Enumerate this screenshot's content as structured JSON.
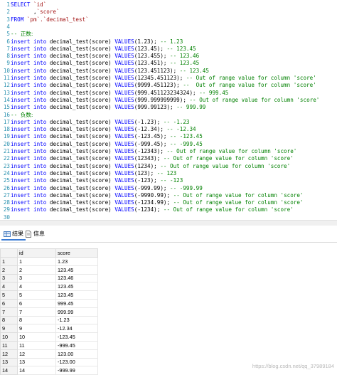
{
  "editor": {
    "lines": [
      {
        "n": "1",
        "segments": [
          {
            "t": "SELECT ",
            "c": "kw"
          },
          {
            "t": "`id`",
            "c": "str"
          }
        ]
      },
      {
        "n": "2",
        "segments": [
          {
            "t": "       ,",
            "c": "plain"
          },
          {
            "t": "`score`",
            "c": "str"
          }
        ]
      },
      {
        "n": "3",
        "segments": [
          {
            "t": "FROM ",
            "c": "kw"
          },
          {
            "t": "`pm`.`decimal_test`",
            "c": "str"
          }
        ]
      },
      {
        "n": "4",
        "segments": []
      },
      {
        "n": "5",
        "segments": [
          {
            "t": "-- ",
            "c": "cm"
          },
          {
            "t": "正数:",
            "c": "cn"
          }
        ]
      },
      {
        "n": "6",
        "segments": [
          {
            "t": "insert into ",
            "c": "kw"
          },
          {
            "t": "decimal_test(score) ",
            "c": "plain"
          },
          {
            "t": "VALUES",
            "c": "kw"
          },
          {
            "t": "(1.23); ",
            "c": "plain"
          },
          {
            "t": "-- 1.23",
            "c": "cm"
          }
        ]
      },
      {
        "n": "7",
        "segments": [
          {
            "t": "insert into ",
            "c": "kw"
          },
          {
            "t": "decimal_test(score) ",
            "c": "plain"
          },
          {
            "t": "VALUES",
            "c": "kw"
          },
          {
            "t": "(123.45); ",
            "c": "plain"
          },
          {
            "t": "-- 123.45",
            "c": "cm"
          }
        ]
      },
      {
        "n": "8",
        "segments": [
          {
            "t": "insert into ",
            "c": "kw"
          },
          {
            "t": "decimal_test(score) ",
            "c": "plain"
          },
          {
            "t": "VALUES",
            "c": "kw"
          },
          {
            "t": "(123.455); ",
            "c": "plain"
          },
          {
            "t": "-- 123.46",
            "c": "cm"
          }
        ]
      },
      {
        "n": "9",
        "segments": [
          {
            "t": "insert into ",
            "c": "kw"
          },
          {
            "t": "decimal_test(score) ",
            "c": "plain"
          },
          {
            "t": "VALUES",
            "c": "kw"
          },
          {
            "t": "(123.451); ",
            "c": "plain"
          },
          {
            "t": "-- 123.45",
            "c": "cm"
          }
        ]
      },
      {
        "n": "10",
        "segments": [
          {
            "t": "insert into ",
            "c": "kw"
          },
          {
            "t": "decimal_test(score) ",
            "c": "plain"
          },
          {
            "t": "VALUES",
            "c": "kw"
          },
          {
            "t": "(123.451123); ",
            "c": "plain"
          },
          {
            "t": "-- 123.45",
            "c": "cm"
          }
        ]
      },
      {
        "n": "11",
        "segments": [
          {
            "t": "insert into ",
            "c": "kw"
          },
          {
            "t": "decimal_test(score) ",
            "c": "plain"
          },
          {
            "t": "VALUES",
            "c": "kw"
          },
          {
            "t": "(12345.451123); ",
            "c": "plain"
          },
          {
            "t": "-- Out of range value for column 'score'",
            "c": "cm"
          }
        ]
      },
      {
        "n": "12",
        "segments": [
          {
            "t": "insert into ",
            "c": "kw"
          },
          {
            "t": "decimal_test(score) ",
            "c": "plain"
          },
          {
            "t": "VALUES",
            "c": "kw"
          },
          {
            "t": "(9999.451123); ",
            "c": "plain"
          },
          {
            "t": "--  Out of range value for column 'score'",
            "c": "cm"
          }
        ]
      },
      {
        "n": "13",
        "segments": [
          {
            "t": "insert into ",
            "c": "kw"
          },
          {
            "t": "decimal_test(score) ",
            "c": "plain"
          },
          {
            "t": "VALUES",
            "c": "kw"
          },
          {
            "t": "(999.451123234324); ",
            "c": "plain"
          },
          {
            "t": "-- 999.45",
            "c": "cm"
          }
        ]
      },
      {
        "n": "14",
        "segments": [
          {
            "t": "insert into ",
            "c": "kw"
          },
          {
            "t": "decimal_test(score) ",
            "c": "plain"
          },
          {
            "t": "VALUES",
            "c": "kw"
          },
          {
            "t": "(999.999999999); ",
            "c": "plain"
          },
          {
            "t": "-- Out of range value for column 'score'",
            "c": "cm"
          }
        ]
      },
      {
        "n": "15",
        "segments": [
          {
            "t": "insert into ",
            "c": "kw"
          },
          {
            "t": "decimal_test(score) ",
            "c": "plain"
          },
          {
            "t": "VALUES",
            "c": "kw"
          },
          {
            "t": "(999.99123); ",
            "c": "plain"
          },
          {
            "t": "-- 999.99",
            "c": "cm"
          }
        ]
      },
      {
        "n": "16",
        "segments": [
          {
            "t": "-- ",
            "c": "cm"
          },
          {
            "t": "负数:",
            "c": "cn"
          }
        ]
      },
      {
        "n": "17",
        "segments": [
          {
            "t": "insert into ",
            "c": "kw"
          },
          {
            "t": "decimal_test(score) ",
            "c": "plain"
          },
          {
            "t": "VALUES",
            "c": "kw"
          },
          {
            "t": "(-1.23); ",
            "c": "plain"
          },
          {
            "t": "-- -1.23",
            "c": "cm"
          }
        ]
      },
      {
        "n": "18",
        "segments": [
          {
            "t": "insert into ",
            "c": "kw"
          },
          {
            "t": "decimal_test(score) ",
            "c": "plain"
          },
          {
            "t": "VALUES",
            "c": "kw"
          },
          {
            "t": "(-12.34); ",
            "c": "plain"
          },
          {
            "t": "-- -12.34",
            "c": "cm"
          }
        ]
      },
      {
        "n": "19",
        "segments": [
          {
            "t": "insert into ",
            "c": "kw"
          },
          {
            "t": "decimal_test(score) ",
            "c": "plain"
          },
          {
            "t": "VALUES",
            "c": "kw"
          },
          {
            "t": "(-123.45); ",
            "c": "plain"
          },
          {
            "t": "-- -123.45",
            "c": "cm"
          }
        ]
      },
      {
        "n": "20",
        "segments": [
          {
            "t": "insert into ",
            "c": "kw"
          },
          {
            "t": "decimal_test(score) ",
            "c": "plain"
          },
          {
            "t": "VALUES",
            "c": "kw"
          },
          {
            "t": "(-999.45); ",
            "c": "plain"
          },
          {
            "t": "-- -999.45",
            "c": "cm"
          }
        ]
      },
      {
        "n": "21",
        "segments": [
          {
            "t": "insert into ",
            "c": "kw"
          },
          {
            "t": "decimal_test(score) ",
            "c": "plain"
          },
          {
            "t": "VALUES",
            "c": "kw"
          },
          {
            "t": "(-12343); ",
            "c": "plain"
          },
          {
            "t": "-- Out of range value for column 'score'",
            "c": "cm"
          }
        ]
      },
      {
        "n": "22",
        "segments": [
          {
            "t": "insert into ",
            "c": "kw"
          },
          {
            "t": "decimal_test(score) ",
            "c": "plain"
          },
          {
            "t": "VALUES",
            "c": "kw"
          },
          {
            "t": "(12343); ",
            "c": "plain"
          },
          {
            "t": "-- Out of range value for column 'score'",
            "c": "cm"
          }
        ]
      },
      {
        "n": "23",
        "segments": [
          {
            "t": "insert into ",
            "c": "kw"
          },
          {
            "t": "decimal_test(score) ",
            "c": "plain"
          },
          {
            "t": "VALUES",
            "c": "kw"
          },
          {
            "t": "(1234); ",
            "c": "plain"
          },
          {
            "t": "-- Out of range value for column 'score'",
            "c": "cm"
          }
        ]
      },
      {
        "n": "24",
        "segments": [
          {
            "t": "insert into ",
            "c": "kw"
          },
          {
            "t": "decimal_test(score) ",
            "c": "plain"
          },
          {
            "t": "VALUES",
            "c": "kw"
          },
          {
            "t": "(123); ",
            "c": "plain"
          },
          {
            "t": "-- 123",
            "c": "cm"
          }
        ]
      },
      {
        "n": "25",
        "segments": [
          {
            "t": "insert into ",
            "c": "kw"
          },
          {
            "t": "decimal_test(score) ",
            "c": "plain"
          },
          {
            "t": "VALUES",
            "c": "kw"
          },
          {
            "t": "(-123); ",
            "c": "plain"
          },
          {
            "t": "-- -123",
            "c": "cm"
          }
        ]
      },
      {
        "n": "26",
        "segments": [
          {
            "t": "insert into ",
            "c": "kw"
          },
          {
            "t": "decimal_test(score) ",
            "c": "plain"
          },
          {
            "t": "VALUES",
            "c": "kw"
          },
          {
            "t": "(-999.99); ",
            "c": "plain"
          },
          {
            "t": "-- -999.99",
            "c": "cm"
          }
        ]
      },
      {
        "n": "27",
        "segments": [
          {
            "t": "insert into ",
            "c": "kw"
          },
          {
            "t": "decimal_test(score) ",
            "c": "plain"
          },
          {
            "t": "VALUES",
            "c": "kw"
          },
          {
            "t": "(-9990.99); ",
            "c": "plain"
          },
          {
            "t": "-- Out of range value for column 'score'",
            "c": "cm"
          }
        ]
      },
      {
        "n": "28",
        "segments": [
          {
            "t": "insert into ",
            "c": "kw"
          },
          {
            "t": "decimal_test(score) ",
            "c": "plain"
          },
          {
            "t": "VALUES",
            "c": "kw"
          },
          {
            "t": "(-1234.99); ",
            "c": "plain"
          },
          {
            "t": "-- Out of range value for column 'score'",
            "c": "cm"
          }
        ]
      },
      {
        "n": "29",
        "segments": [
          {
            "t": "insert into ",
            "c": "kw"
          },
          {
            "t": "decimal_test(score) ",
            "c": "plain"
          },
          {
            "t": "VALUES",
            "c": "kw"
          },
          {
            "t": "(-1234); ",
            "c": "plain"
          },
          {
            "t": "-- Out of range value for column 'score'",
            "c": "cm"
          }
        ]
      },
      {
        "n": "30",
        "segments": []
      }
    ]
  },
  "tabs": [
    {
      "label": "结果",
      "icon": "grid-icon",
      "active": true
    },
    {
      "label": "信息",
      "icon": "info-page-icon",
      "active": false
    }
  ],
  "grid": {
    "columns": [
      "id",
      "score"
    ],
    "rows": [
      {
        "rn": "1",
        "cells": [
          "1",
          "1.23"
        ]
      },
      {
        "rn": "2",
        "cells": [
          "2",
          "123.45"
        ]
      },
      {
        "rn": "3",
        "cells": [
          "3",
          "123.46"
        ]
      },
      {
        "rn": "4",
        "cells": [
          "4",
          "123.45"
        ]
      },
      {
        "rn": "5",
        "cells": [
          "5",
          "123.45"
        ]
      },
      {
        "rn": "6",
        "cells": [
          "6",
          "999.45"
        ]
      },
      {
        "rn": "7",
        "cells": [
          "7",
          "999.99"
        ]
      },
      {
        "rn": "8",
        "cells": [
          "8",
          "-1.23"
        ]
      },
      {
        "rn": "9",
        "cells": [
          "9",
          "-12.34"
        ]
      },
      {
        "rn": "10",
        "cells": [
          "10",
          "-123.45"
        ]
      },
      {
        "rn": "11",
        "cells": [
          "11",
          "-999.45"
        ]
      },
      {
        "rn": "12",
        "cells": [
          "12",
          "123.00"
        ]
      },
      {
        "rn": "13",
        "cells": [
          "13",
          "-123.00"
        ]
      },
      {
        "rn": "14",
        "cells": [
          "14",
          "-999.99"
        ]
      }
    ]
  },
  "watermark": "https://blog.csdn.net/qq_37989184",
  "colors": {
    "keyword": "#0000ff",
    "string": "#a31515",
    "comment": "#008000",
    "line_number": "#2b91af"
  }
}
